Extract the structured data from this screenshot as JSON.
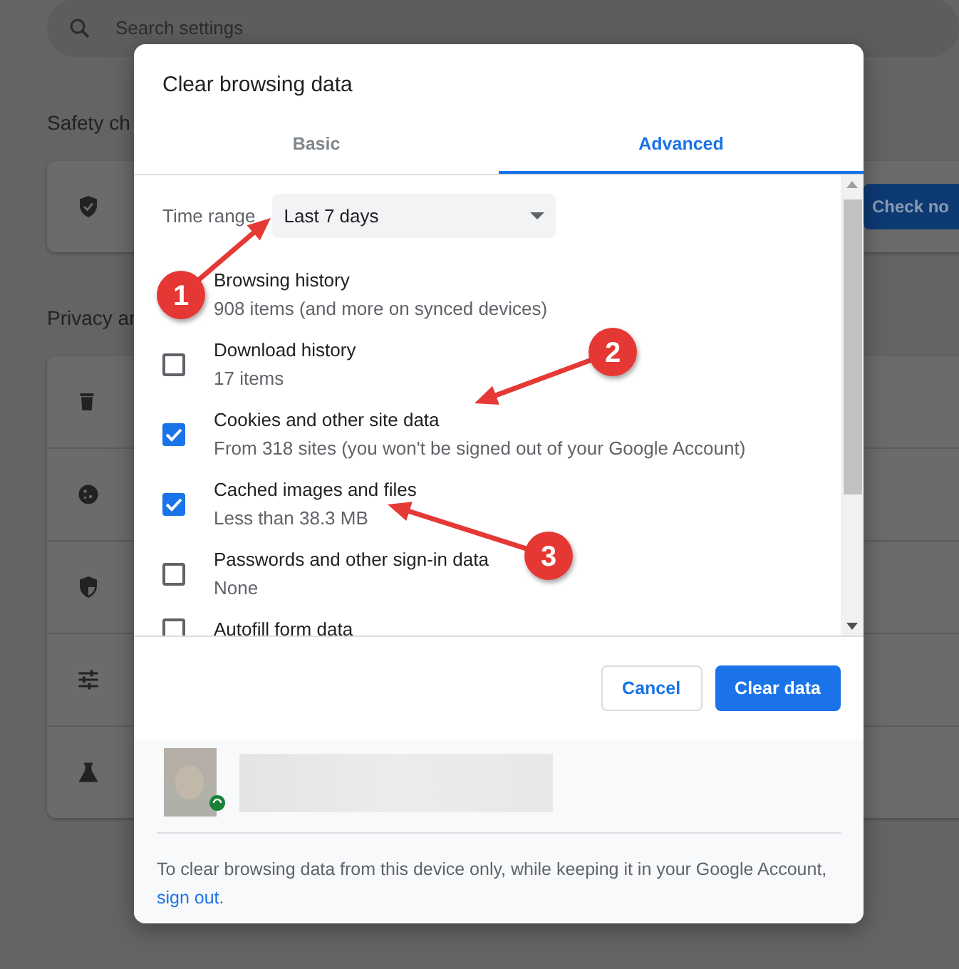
{
  "background": {
    "search": {
      "placeholder": "Search settings"
    },
    "safety": {
      "heading": "Safety ch",
      "button": "Check no"
    },
    "privacy": {
      "heading": "Privacy ar"
    }
  },
  "dialog": {
    "title": "Clear browsing data",
    "tabs": [
      {
        "label": "Basic",
        "selected": false
      },
      {
        "label": "Advanced",
        "selected": true
      }
    ],
    "time_range": {
      "label": "Time range",
      "value": "Last 7 days"
    },
    "items": [
      {
        "title": "Browsing history",
        "subtitle": "908 items (and more on synced devices)"
      },
      {
        "title": "Download history",
        "subtitle": "17 items",
        "checked": false
      },
      {
        "title": "Cookies and other site data",
        "subtitle": "From 318 sites (you won't be signed out of your Google Account)",
        "checked": true
      },
      {
        "title": "Cached images and files",
        "subtitle": "Less than 38.3 MB",
        "checked": true
      },
      {
        "title": "Passwords and other sign-in data",
        "subtitle": "None",
        "checked": false
      },
      {
        "title": "Autofill form data",
        "checked": false
      }
    ],
    "buttons": [
      {
        "label": "Cancel",
        "kind": "secondary"
      },
      {
        "label": "Clear data",
        "kind": "primary"
      }
    ],
    "note": "To clear browsing data from this device only, while keeping it in your Google Account, ",
    "note_link": "sign out",
    "note_end": "."
  },
  "annotations": [
    {
      "number": "1"
    },
    {
      "number": "2"
    },
    {
      "number": "3"
    }
  ]
}
